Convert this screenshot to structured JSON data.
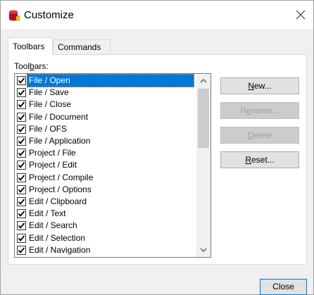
{
  "window": {
    "title": "Customize"
  },
  "tabs": [
    {
      "label": "Toolbars",
      "active": true
    },
    {
      "label": "Commands",
      "active": false
    }
  ],
  "toolbars_label": {
    "pre": "Tool",
    "mnemonic": "b",
    "post": "ars:"
  },
  "toolbars": [
    {
      "label": "File / Open",
      "checked": true,
      "selected": true
    },
    {
      "label": "File / Save",
      "checked": true
    },
    {
      "label": "File / Close",
      "checked": true
    },
    {
      "label": "File / Document",
      "checked": true
    },
    {
      "label": "File / OFS",
      "checked": true
    },
    {
      "label": "File / Application",
      "checked": true
    },
    {
      "label": "Project / File",
      "checked": true
    },
    {
      "label": "Project / Edit",
      "checked": true
    },
    {
      "label": "Project / Compile",
      "checked": true
    },
    {
      "label": "Project / Options",
      "checked": true
    },
    {
      "label": "Edit / Clipboard",
      "checked": true
    },
    {
      "label": "Edit / Text",
      "checked": true
    },
    {
      "label": "Edit / Search",
      "checked": true
    },
    {
      "label": "Edit / Selection",
      "checked": true
    },
    {
      "label": "Edit / Navigation",
      "checked": true
    }
  ],
  "buttons": {
    "new": {
      "mnemonic": "N",
      "rest": "ew...",
      "enabled": true
    },
    "rename": {
      "pre": "R",
      "mnemonic": "e",
      "rest": "name...",
      "enabled": false
    },
    "delete": {
      "mnemonic": "D",
      "rest": "elete",
      "enabled": false
    },
    "reset": {
      "mnemonic": "R",
      "rest": "eset...",
      "enabled": true
    },
    "close": {
      "label": "Close"
    }
  },
  "colors": {
    "selection": "#0078d7",
    "app_icon": "#c1121f"
  },
  "icons": {
    "app": "database-stack-icon",
    "close": "close-icon",
    "scroll_up": "chevron-up-icon",
    "scroll_down": "chevron-down-icon",
    "check": "checkmark-icon"
  }
}
